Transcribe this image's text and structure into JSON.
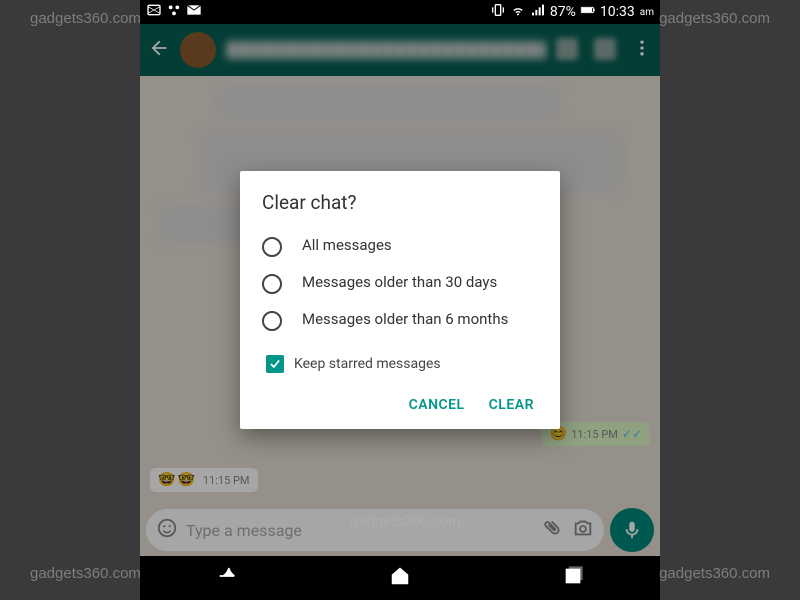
{
  "statusbar": {
    "battery_percent": "87%",
    "time": "10:33",
    "time_suffix": "am"
  },
  "chat": {
    "time1": "11:15 PM",
    "time2": "11:15 PM",
    "emoji_nerd": "🤓",
    "emoji_blush": "😊"
  },
  "input": {
    "placeholder": "Type a message"
  },
  "dialog": {
    "title": "Clear chat?",
    "options": [
      "All messages",
      "Messages older than 30 days",
      "Messages older than 6 months"
    ],
    "checkbox_label": "Keep starred messages",
    "checkbox_checked": true,
    "cancel_label": "CANCEL",
    "clear_label": "CLEAR"
  },
  "watermark": "gadgets360.com"
}
